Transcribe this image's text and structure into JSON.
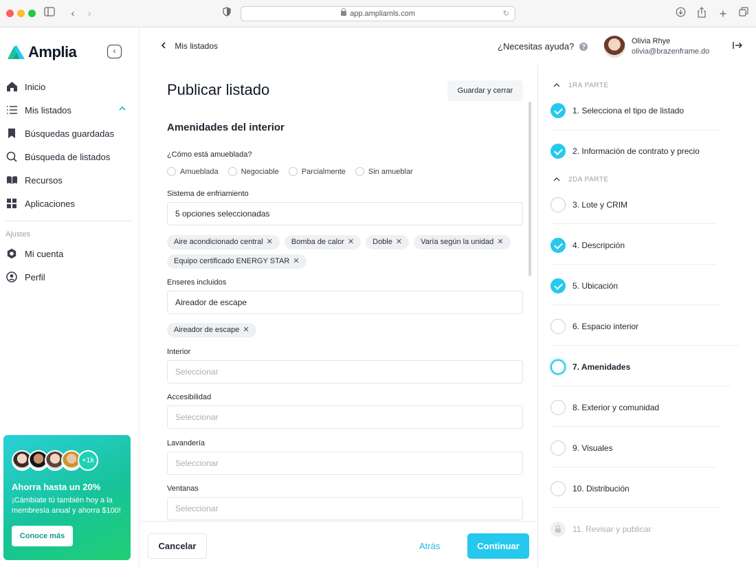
{
  "browser": {
    "url": "app.ampliamls.com"
  },
  "brand": {
    "name": "Amplia",
    "accent": "#27c8ee",
    "green": "#17c39a"
  },
  "sidebar": {
    "items": [
      {
        "label": "Inicio",
        "icon": "home-icon"
      },
      {
        "label": "Mis listados",
        "icon": "list-icon"
      },
      {
        "label": "Búsquedas guardadas",
        "icon": "bookmark-icon"
      },
      {
        "label": "Búsqueda de listados",
        "icon": "search-icon"
      },
      {
        "label": "Recursos",
        "icon": "book-icon"
      },
      {
        "label": "Aplicaciones",
        "icon": "grid-icon"
      }
    ],
    "settings_label": "Ajustes",
    "settings_items": [
      {
        "label": "Mi cuenta",
        "icon": "gear-icon"
      },
      {
        "label": "Perfil",
        "icon": "profile-icon"
      }
    ],
    "promo": {
      "count": "+1k",
      "title": "Ahorra hasta un 20%",
      "text": "¡Cámbiate tú también hoy a la membresía anual y ahorra $100!",
      "button": "Conoce más"
    }
  },
  "header": {
    "back_label": "Mis listados",
    "help_label": "¿Necesitas ayuda?",
    "user_name": "Olivia Rhye",
    "user_email": "olivia@brazenframe.do"
  },
  "form": {
    "title": "Publicar listado",
    "save_label": "Guardar y cerrar",
    "section_title": "Amenidades del interior",
    "furnished": {
      "label": "¿Cómo está amueblada?",
      "options": [
        "Amueblada",
        "Negociable",
        "Parcialmente",
        "Sin amueblar"
      ]
    },
    "cooling": {
      "label": "Sistema de enfriamiento",
      "value": "5 opciones seleccionadas",
      "chips": [
        "Aire acondicionado central",
        "Bomba de calor",
        "Doble",
        "Varía según la unidad",
        "Equipo certificado ENERGY STAR"
      ]
    },
    "appliances": {
      "label": "Enseres incluidos",
      "value": "Aireador de escape",
      "chips": [
        "Aireador de escape"
      ]
    },
    "interior": {
      "label": "Interior",
      "placeholder": "Seleccionar"
    },
    "accessibility": {
      "label": "Accesibilidad",
      "placeholder": "Seleccionar"
    },
    "laundry": {
      "label": "Lavandería",
      "placeholder": "Seleccionar"
    },
    "windows": {
      "label": "Ventanas",
      "placeholder": "Seleccionar"
    }
  },
  "footer": {
    "cancel": "Cancelar",
    "back": "Atrás",
    "continue": "Continuar"
  },
  "steps": {
    "part1": "1RA PARTE",
    "part2": "2DA PARTE",
    "items": [
      {
        "label": "1. Selecciona el tipo de listado",
        "state": "done"
      },
      {
        "label": "2. Información de contrato y precio",
        "state": "done"
      },
      {
        "label": "3. Lote y CRIM",
        "state": "todo"
      },
      {
        "label": "4. Descripción",
        "state": "done"
      },
      {
        "label": "5. Ubicación",
        "state": "done"
      },
      {
        "label": "6. Espacio interior",
        "state": "todo"
      },
      {
        "label": "7. Amenidades",
        "state": "current"
      },
      {
        "label": "8. Exterior y comunidad",
        "state": "todo"
      },
      {
        "label": "9. Visuales",
        "state": "todo"
      },
      {
        "label": "10. Distribución",
        "state": "todo"
      },
      {
        "label": "11. Revisar y publicar",
        "state": "locked"
      }
    ]
  }
}
